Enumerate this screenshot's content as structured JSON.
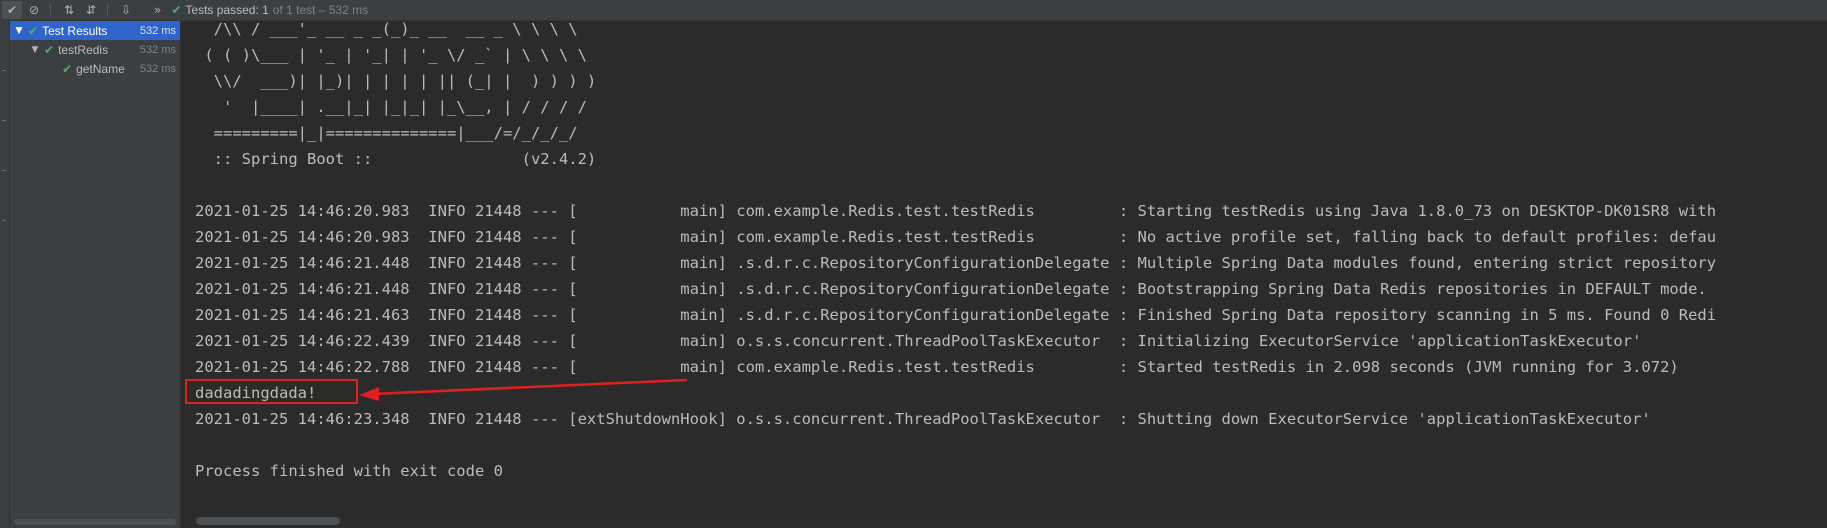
{
  "toolbar": {
    "buttons": [
      {
        "name": "show-passed-icon",
        "glyph": "✔"
      },
      {
        "name": "show-ignored-icon",
        "glyph": "⊘"
      },
      {
        "name": "sort-alpha-icon",
        "glyph": "⇅"
      },
      {
        "name": "sort-duration-icon",
        "glyph": "⇵"
      },
      {
        "name": "import-icon",
        "glyph": "⇩"
      }
    ],
    "more_glyph": "»",
    "status_passed": "Tests passed: 1",
    "status_detail": "of 1 test – 532 ms"
  },
  "tree": {
    "items": [
      {
        "label": "Test Results",
        "duration": "532 ms",
        "arrow": "▼",
        "indent": 0,
        "selected": true
      },
      {
        "label": "testRedis",
        "duration": "532 ms",
        "arrow": "▼",
        "indent": 1,
        "selected": false
      },
      {
        "label": "getName",
        "duration": "532 ms",
        "arrow": "",
        "indent": 2,
        "selected": false
      }
    ]
  },
  "console": {
    "lines": [
      "  /\\\\ / ___'_ __ _ _(_)_ __  __ _ \\ \\ \\ \\",
      " ( ( )\\___ | '_ | '_| | '_ \\/ _` | \\ \\ \\ \\",
      "  \\\\/  ___)| |_)| | | | | || (_| |  ) ) ) )",
      "   '  |____| .__|_| |_|_| |_\\__, | / / / /",
      "  =========|_|==============|___/=/_/_/_/",
      "  :: Spring Boot ::                (v2.4.2)",
      "",
      "2021-01-25 14:46:20.983  INFO 21448 --- [           main] com.example.Redis.test.testRedis         : Starting testRedis using Java 1.8.0_73 on DESKTOP-DK01SR8 with",
      "2021-01-25 14:46:20.983  INFO 21448 --- [           main] com.example.Redis.test.testRedis         : No active profile set, falling back to default profiles: defau",
      "2021-01-25 14:46:21.448  INFO 21448 --- [           main] .s.d.r.c.RepositoryConfigurationDelegate : Multiple Spring Data modules found, entering strict repository",
      "2021-01-25 14:46:21.448  INFO 21448 --- [           main] .s.d.r.c.RepositoryConfigurationDelegate : Bootstrapping Spring Data Redis repositories in DEFAULT mode.",
      "2021-01-25 14:46:21.463  INFO 21448 --- [           main] .s.d.r.c.RepositoryConfigurationDelegate : Finished Spring Data repository scanning in 5 ms. Found 0 Redi",
      "2021-01-25 14:46:22.439  INFO 21448 --- [           main] o.s.s.concurrent.ThreadPoolTaskExecutor  : Initializing ExecutorService 'applicationTaskExecutor'",
      "2021-01-25 14:46:22.788  INFO 21448 --- [           main] com.example.Redis.test.testRedis         : Started testRedis in 2.098 seconds (JVM running for 3.072)",
      "dadadingdada!",
      "2021-01-25 14:46:23.348  INFO 21448 --- [extShutdownHook] o.s.s.concurrent.ThreadPoolTaskExecutor  : Shutting down ExecutorService 'applicationTaskExecutor'",
      "",
      "Process finished with exit code 0"
    ],
    "highlighted_line": 14
  },
  "colors": {
    "check_green": "#59a869",
    "selection_blue": "#2f65ca",
    "annotation_red": "#e02020"
  }
}
